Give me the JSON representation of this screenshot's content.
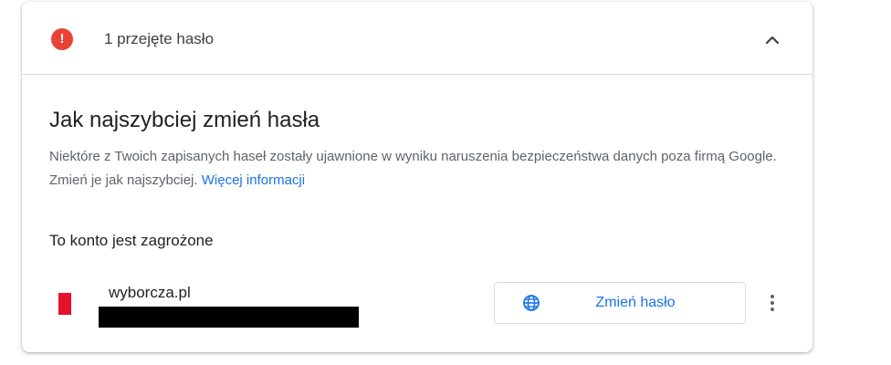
{
  "header": {
    "alert_icon_glyph": "!",
    "title": "1 przejęte hasło"
  },
  "section": {
    "title": "Jak najszybciej zmień hasła",
    "description": "Niektóre z Twoich zapisanych haseł zostały ujawnione w wyniku naruszenia bezpieczeństwa danych poza firmą Google. Zmień je jak najszybciej. ",
    "link_label": "Więcej informacji"
  },
  "account": {
    "heading": "To konto jest zagrożone",
    "site": "wyborcza.pl",
    "username_redacted": true,
    "change_button_label": "Zmień hasło"
  },
  "icons": {
    "alert": "alert-circle-icon",
    "collapse": "chevron-up-icon",
    "globe": "globe-icon",
    "more": "more-vert-icon",
    "favicon": "site-favicon-icon"
  },
  "colors": {
    "alert_red": "#e94235",
    "link_blue": "#1a73e8",
    "favicon_red": "#e5122f"
  }
}
